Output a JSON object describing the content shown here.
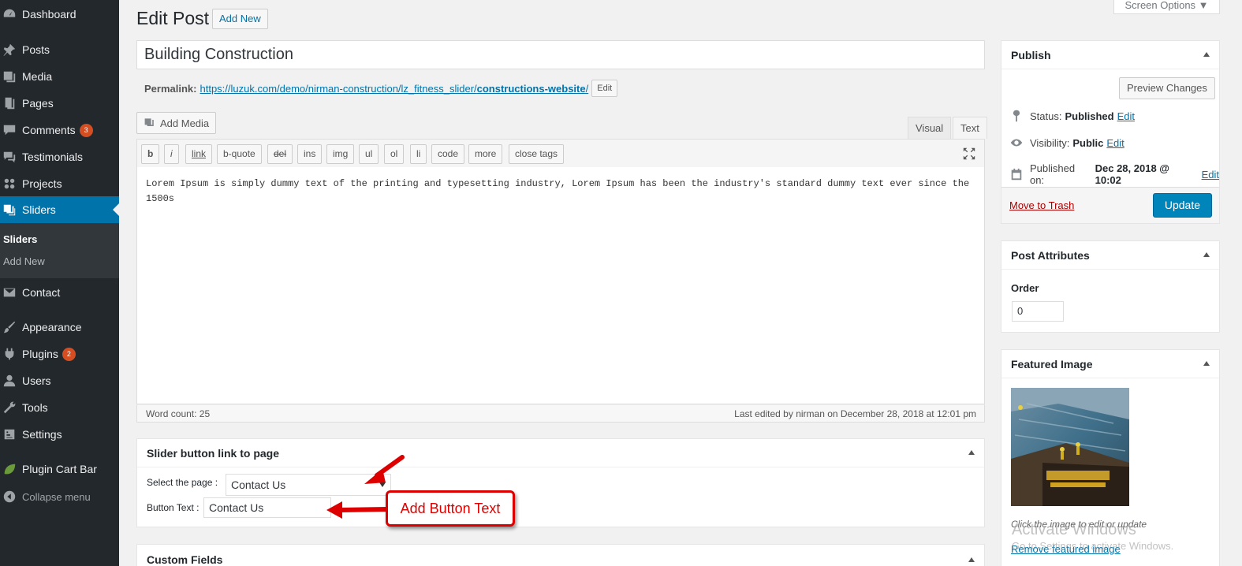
{
  "sidebar": {
    "items": [
      {
        "label": "Dashboard",
        "icon": "dashboard-icon"
      },
      {
        "label": "Posts",
        "icon": "pin-icon"
      },
      {
        "label": "Media",
        "icon": "media-icon"
      },
      {
        "label": "Pages",
        "icon": "pages-icon"
      },
      {
        "label": "Comments",
        "icon": "comment-icon",
        "badge": "3"
      },
      {
        "label": "Testimonials",
        "icon": "testimonial-icon"
      },
      {
        "label": "Projects",
        "icon": "projects-icon"
      },
      {
        "label": "Sliders",
        "icon": "sliders-icon"
      },
      {
        "label": "Contact",
        "icon": "mail-icon"
      },
      {
        "label": "Appearance",
        "icon": "brush-icon"
      },
      {
        "label": "Plugins",
        "icon": "plug-icon",
        "badge": "2"
      },
      {
        "label": "Users",
        "icon": "user-icon"
      },
      {
        "label": "Tools",
        "icon": "wrench-icon"
      },
      {
        "label": "Settings",
        "icon": "settings-icon"
      },
      {
        "label": "Plugin Cart Bar",
        "icon": "leaf-icon"
      }
    ],
    "submenu": {
      "current": "Sliders",
      "add_new": "Add New"
    },
    "collapse": "Collapse menu"
  },
  "header": {
    "title": "Edit Post",
    "add_new": "Add New",
    "screen_options": "Screen Options ▼"
  },
  "post": {
    "title": "Building Construction",
    "permalink_label": "Permalink:",
    "permalink_base": "https://luzuk.com/demo/nirman-construction/lz_fitness_slider/",
    "permalink_slug": "constructions-website",
    "permalink_tail": "/",
    "permalink_edit": "Edit"
  },
  "editor": {
    "add_media": "Add Media",
    "tab_visual": "Visual",
    "tab_text": "Text",
    "buttons": [
      "b",
      "i",
      "link",
      "b-quote",
      "del",
      "ins",
      "img",
      "ul",
      "ol",
      "li",
      "code",
      "more",
      "close tags"
    ],
    "content": "Lorem Ipsum is simply dummy text of the printing and typesetting industry, Lorem Ipsum has been the industry's standard dummy text ever since the 1500s",
    "word_count": "Word count: 25",
    "last_edited": "Last edited by nirman on December 28, 2018 at 12:01 pm"
  },
  "slider_box": {
    "title": "Slider button link to page",
    "select_label": "Select the page :",
    "select_value": "Contact Us",
    "button_text_label": "Button Text :",
    "button_text_value": "Contact Us",
    "annotation": "Add Button Text",
    "annotation_color": "#dd0000"
  },
  "custom_fields": {
    "title": "Custom Fields"
  },
  "publish": {
    "title": "Publish",
    "preview": "Preview Changes",
    "status_label": "Status:",
    "status_value": "Published",
    "visibility_label": "Visibility:",
    "visibility_value": "Public",
    "published_label": "Published on:",
    "published_value": "Dec 28, 2018 @ 10:02",
    "edit": "Edit",
    "trash": "Move to Trash",
    "update": "Update"
  },
  "attributes": {
    "title": "Post Attributes",
    "order_label": "Order",
    "order_value": "0"
  },
  "featured": {
    "title": "Featured Image",
    "caption": "Click the image to edit or update",
    "remove": "Remove featured image"
  },
  "watermark": {
    "line1": "Activate Windows",
    "line2": "Go to Settings to activate Windows."
  },
  "colors": {
    "sidebar_bg": "#23282d",
    "accent": "#0073aa",
    "primary_button": "#0085ba",
    "badge": "#d54e21"
  }
}
